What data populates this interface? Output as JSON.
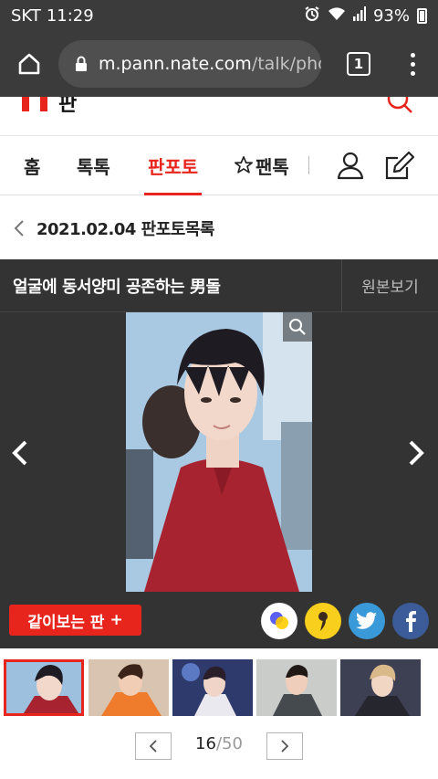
{
  "status_bar": {
    "carrier": "SKT",
    "time": "11:29",
    "battery": "93%"
  },
  "browser": {
    "url_host": "m.pann.nate.com",
    "url_path": "/talk/pho",
    "tab_count": "1"
  },
  "site": {
    "logo_text": "판"
  },
  "nav": {
    "items": [
      "홈",
      "톡톡",
      "판포토",
      "팬톡"
    ],
    "active": "판포토"
  },
  "breadcrumb": {
    "text": "2021.02.04 판포토목록"
  },
  "photo_view": {
    "title": "얼굴에 동서양미 공존하는 男돌",
    "original_label": "원본보기"
  },
  "share": {
    "together_label": "같이보는 판",
    "together_plus": "+"
  },
  "pager": {
    "current": "16",
    "separator": "/",
    "total": "50"
  },
  "colors": {
    "accent": "#e8251d",
    "dark_bg": "#333333",
    "twitter": "#3a9ad9",
    "facebook": "#3b5b99",
    "kakao": "#f7cf1c"
  }
}
